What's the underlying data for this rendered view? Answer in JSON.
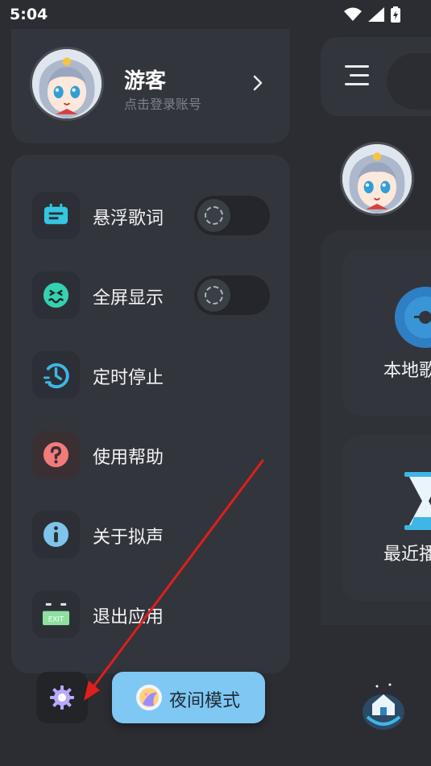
{
  "status_bar": {
    "time": "5:04",
    "icons": [
      "wifi-icon",
      "signal-icon",
      "battery-charging-icon"
    ]
  },
  "profile": {
    "name": "游客",
    "subtitle": "点击登录账号",
    "avatar": "anime-avatar"
  },
  "menu": {
    "items": [
      {
        "label": "悬浮歌词",
        "icon": "floating-lyrics-icon",
        "toggle": true,
        "toggle_on": false,
        "color": "#35c6e0"
      },
      {
        "label": "全屏显示",
        "icon": "fullscreen-icon",
        "toggle": true,
        "toggle_on": false,
        "color": "#36d1b0"
      },
      {
        "label": "定时停止",
        "icon": "timer-icon",
        "toggle": false,
        "color": "#3fb6e6"
      },
      {
        "label": "使用帮助",
        "icon": "help-icon",
        "toggle": false,
        "color": "#f27b7b"
      },
      {
        "label": "关于拟声",
        "icon": "info-icon",
        "toggle": false,
        "color": "#7fc4ea"
      },
      {
        "label": "退出应用",
        "icon": "exit-icon",
        "toggle": false,
        "color": "#8fe0a0"
      }
    ]
  },
  "bottom": {
    "settings_icon": "gear-icon",
    "night_mode_label": "夜间模式",
    "night_mode_icon": "moon-icon",
    "accent": "#7ec8f3"
  },
  "main_peek": {
    "tiles": [
      {
        "label": "本地歌",
        "icon": "vinyl-icon"
      },
      {
        "label": "最近播",
        "icon": "hourglass-icon"
      }
    ],
    "bottom_icon": "home-icon"
  },
  "annotation": {
    "arrow_color": "#e11d1d"
  }
}
